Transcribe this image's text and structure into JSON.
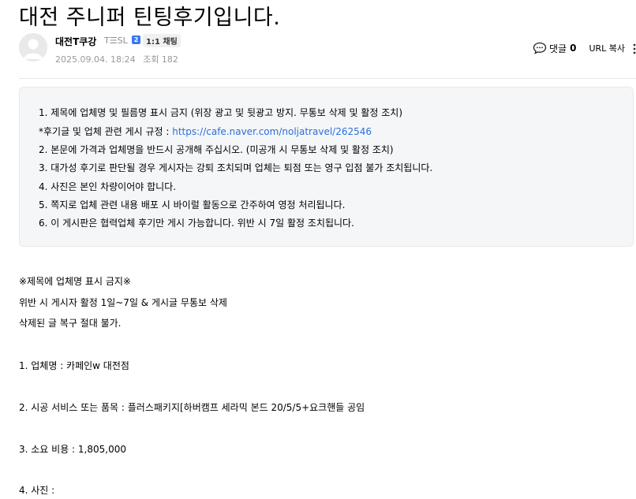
{
  "post": {
    "title": "대전 주니퍼 틴팅후기입니다."
  },
  "author": {
    "name": "대전T쿠강",
    "mbti": "T☰SL",
    "level_badge": "2",
    "chat_badge": "1:1 채팅",
    "date": "2025.09.04. 18:24",
    "views_label": "조회 182",
    "avatar_icon": "default-profile-icon"
  },
  "actions": {
    "comment_icon": "speech-bubble-icon",
    "comment_label": "댓글",
    "comment_count": "0",
    "url_copy_label": "URL 복사",
    "more_icon": "vertical-dots-icon"
  },
  "notice": {
    "line1": "1. 제목에 업체명 및 필름명 표시 금지 (위장 광고 및 뒷광고 방지. 무통보 삭제 및 활정 조치)",
    "line2_prefix": "*후기글 및 업체 관련 게시 규정 : ",
    "line2_link": "https://cafe.naver.com/noljatravel/262546",
    "line3": "2. 본문에 가격과 업체명을 반드시 공개해 주십시오. (미공개 시 무통보 삭제 및 활정 조치)",
    "line4": "3. 대가성 후기로 판단될 경우 게시자는 강퇴 조치되며 업체는 퇴점 또는 영구 입점 불가 조치됩니다.",
    "line5": "4. 사진은 본인 차량이어야 합니다.",
    "line6": "5. 쪽지로 업체 관련 내용 배포 시 바이럴 활동으로 간주하여 영정 처리됩니다.",
    "line7": "6. 이 게시판은 협력업체 후기만 게시 가능합니다. 위반 시 7일 활정 조치됩니다."
  },
  "content": {
    "warn1": "※제목에 업체명 표시 금지※",
    "warn2": "위반 시 게시자 활정 1일~7일 & 게시글 무통보 삭제",
    "warn3": "삭제된 글 복구 절대 불가.",
    "item1": "1. 업체명 :  카페인w 대전점",
    "item2": "2. 시공 서비스 또는 품목 :  플러스패키지[하버캠프 세라믹 본드 20/5/5+요크핸들 공임",
    "item3": "3. 소요 비용 :  1,805,000",
    "item4": "4. 사진 :"
  },
  "colors": {
    "link": "#2a6fdc",
    "notice_bg": "#f5f6f8",
    "badge_blue": "#3b78f2"
  }
}
